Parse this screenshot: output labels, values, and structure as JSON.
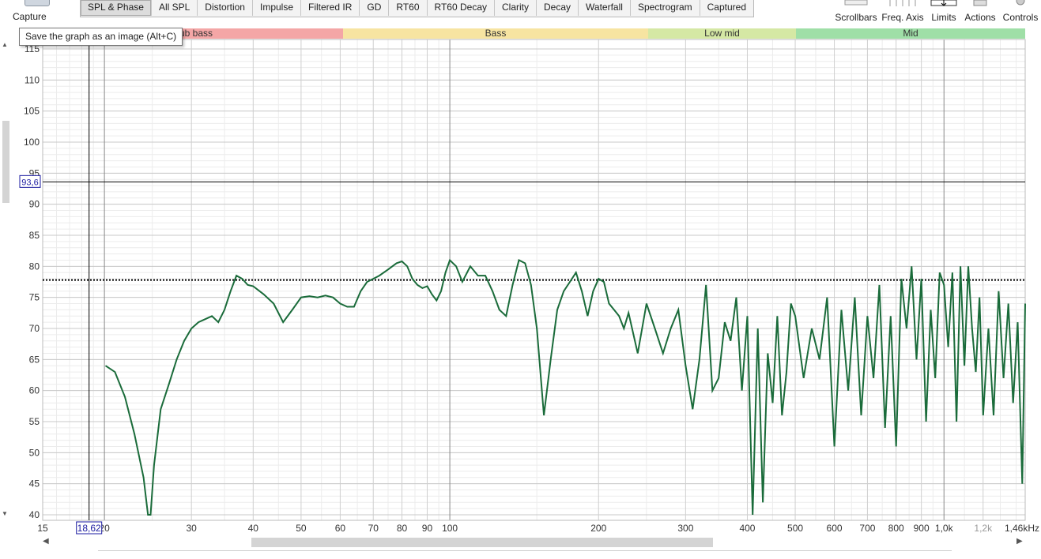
{
  "toolbar": {
    "capture_label": "Capture",
    "tabs": [
      "SPL & Phase",
      "All SPL",
      "Distortion",
      "Impulse",
      "Filtered IR",
      "GD",
      "RT60",
      "RT60 Decay",
      "Clarity",
      "Decay",
      "Waterfall",
      "Spectrogram",
      "Captured"
    ],
    "active_tab": "SPL & Phase",
    "right": [
      "Scrollbars",
      "Freq. Axis",
      "Limits",
      "Actions",
      "Controls"
    ]
  },
  "tooltip": "Save the graph as an image (Alt+C)",
  "bands": [
    {
      "label": "Sub bass",
      "color": "#f4a6a6"
    },
    {
      "label": "Bass",
      "color": "#f7e4a1"
    },
    {
      "label": "Low mid",
      "color": "#d5e8a4"
    },
    {
      "label": "Mid",
      "color": "#9fdfa7"
    }
  ],
  "cursor": {
    "freq_label": "18,62",
    "spl_label": "93,6"
  },
  "chart_data": {
    "type": "line",
    "title": "",
    "xlabel": "",
    "ylabel": "",
    "x_scale": "log",
    "xlim": [
      15,
      1460
    ],
    "ylim": [
      40,
      115
    ],
    "grid": true,
    "y_ticks": [
      115,
      110,
      105,
      100,
      95,
      90,
      85,
      80,
      75,
      70,
      65,
      60,
      55,
      50,
      45,
      40
    ],
    "x_ticks": [
      {
        "f": 15,
        "label": "15"
      },
      {
        "f": 20,
        "label": "20"
      },
      {
        "f": 30,
        "label": "30"
      },
      {
        "f": 40,
        "label": "40"
      },
      {
        "f": 50,
        "label": "50"
      },
      {
        "f": 60,
        "label": "60"
      },
      {
        "f": 70,
        "label": "70"
      },
      {
        "f": 80,
        "label": "80"
      },
      {
        "f": 90,
        "label": "90"
      },
      {
        "f": 100,
        "label": "100"
      },
      {
        "f": 200,
        "label": "200"
      },
      {
        "f": 300,
        "label": "300"
      },
      {
        "f": 400,
        "label": "400"
      },
      {
        "f": 500,
        "label": "500"
      },
      {
        "f": 600,
        "label": "600"
      },
      {
        "f": 700,
        "label": "700"
      },
      {
        "f": 800,
        "label": "800"
      },
      {
        "f": 900,
        "label": "900"
      },
      {
        "f": 1000,
        "label": "1,0k"
      },
      {
        "f": 1200,
        "label": "1,2k"
      },
      {
        "f": 1460,
        "label": "1,46kHz"
      }
    ],
    "reference_level": 77.8,
    "cursor_x": 18.62,
    "cursor_y": 93.6,
    "series_color": "#1a6b3a",
    "series": [
      {
        "x": [
          20.1,
          21,
          22,
          23,
          24,
          24.5,
          24.8,
          25.2,
          26,
          27,
          28,
          29,
          30,
          31,
          32,
          33,
          34,
          35,
          36,
          37,
          38,
          39,
          40,
          42,
          44,
          46,
          48,
          50,
          52,
          54,
          56,
          58,
          60,
          62,
          64,
          66,
          68,
          70,
          72,
          75,
          78,
          80,
          82,
          84,
          86,
          88,
          90,
          92,
          94,
          96,
          98,
          100,
          103,
          106,
          110,
          114,
          118,
          122,
          126,
          130,
          134,
          138,
          142,
          146,
          150,
          155,
          160,
          165,
          170,
          175,
          180,
          185,
          190,
          195,
          200,
          205,
          210,
          215,
          220,
          225,
          230,
          240,
          250,
          260,
          270,
          280,
          290,
          300,
          310,
          320,
          330,
          340,
          350,
          360,
          370,
          380,
          390,
          400,
          410,
          420,
          430,
          440,
          450,
          460,
          470,
          480,
          490,
          500,
          520,
          540,
          560,
          580,
          600,
          620,
          640,
          660,
          680,
          700,
          720,
          740,
          760,
          780,
          800,
          820,
          840,
          860,
          880,
          900,
          920,
          940,
          960,
          980,
          1000,
          1020,
          1040,
          1060,
          1080,
          1100,
          1120,
          1140,
          1160,
          1180,
          1200,
          1230,
          1260,
          1290,
          1320,
          1350,
          1380,
          1410,
          1440,
          1460
        ],
        "y": [
          64,
          63,
          59,
          53,
          46,
          40,
          39,
          48,
          57,
          61,
          65,
          68,
          70,
          71,
          71.5,
          72,
          71,
          73,
          76,
          78.5,
          78,
          77,
          76.8,
          75.5,
          74,
          71,
          73,
          75,
          75.2,
          75,
          75.3,
          75,
          74,
          73.5,
          73.5,
          76,
          77.5,
          78,
          78.5,
          79.5,
          80.5,
          80.8,
          80,
          78,
          77,
          76.5,
          76.8,
          75.5,
          74.5,
          76,
          79,
          81,
          80,
          77.5,
          80,
          78.5,
          78.5,
          76,
          73,
          72,
          77,
          81,
          80.5,
          77,
          70,
          56,
          65,
          73,
          76,
          77.5,
          79,
          76,
          72,
          76,
          78,
          77.5,
          74,
          73,
          72,
          70,
          72.5,
          66,
          74,
          70,
          66,
          70,
          73,
          64,
          57,
          65,
          77,
          60,
          62,
          71,
          68,
          75,
          60,
          72,
          40,
          70,
          42,
          66,
          58,
          72,
          56,
          63,
          74,
          72,
          62,
          70,
          65,
          75,
          51,
          73,
          60,
          75,
          56,
          72,
          62,
          77,
          54,
          72,
          51,
          78,
          70,
          80,
          65,
          78,
          55,
          73,
          62,
          79,
          77,
          67,
          79,
          55,
          80,
          64,
          80,
          70,
          63,
          75,
          56,
          70,
          56,
          76,
          62,
          74,
          58,
          71,
          45,
          74
        ]
      }
    ]
  }
}
